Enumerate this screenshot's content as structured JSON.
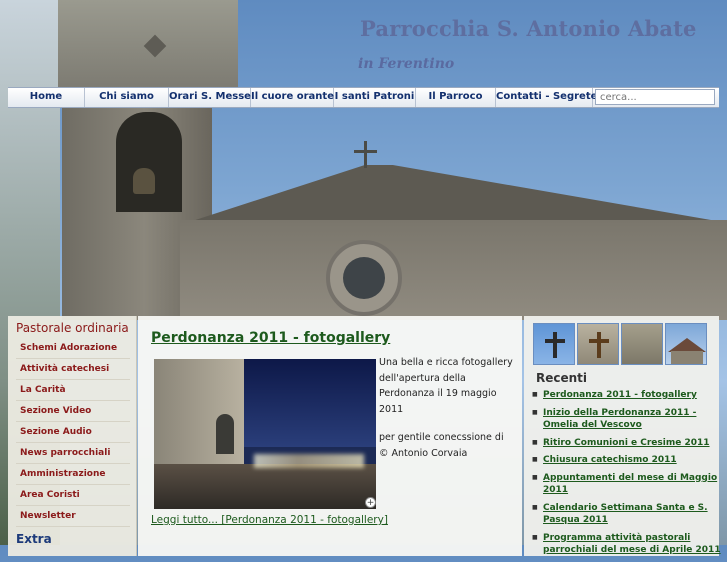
{
  "header": {
    "title": "Parrocchia S. Antonio Abate",
    "subtitle": "in Ferentino"
  },
  "nav": {
    "items": [
      "Home",
      "Chi siamo",
      "Orari S. Messe",
      "Il cuore orante",
      "I santi Patroni",
      "Il Parroco",
      "Contatti - Segreteria"
    ]
  },
  "search": {
    "placeholder": "cerca..."
  },
  "sidebar": {
    "heading": "Pastorale ordinaria",
    "items": [
      "Schemi Adorazione",
      "Attività catechesi",
      "La Carità",
      "Sezione Video",
      "Sezione Audio",
      "News parrocchiali",
      "Amministrazione",
      "Area Coristi",
      "Newsletter"
    ],
    "heading2": "Extra"
  },
  "article": {
    "title": "Perdonanza 2011 - fotogallery",
    "text": "Una bella e ricca fotogallery dell'apertura della Perdonanza il 19 maggio 2011",
    "credit": "per gentile conecssione di © Antonio Corvaia",
    "read_more": "Leggi tutto... [Perdonanza 2011 - fotogallery]"
  },
  "recent": {
    "heading": "Recenti",
    "items": [
      "Perdonanza 2011 - fotogallery",
      "Inizio della Perdonanza 2011 - Omelia del Vescovo",
      "Ritiro Comunioni e Cresime 2011",
      "Chiusura catechismo 2011",
      "Appuntamenti del mese di Maggio 2011",
      "Calendario Settimana Santa e S. Pasqua 2011",
      "Programma attività pastorali parrochiali del mese di Aprile 2011"
    ]
  },
  "thumbnails": [
    "cross-on-sky-icon",
    "iron-cross-icon",
    "stone-wall-icon",
    "church-roof-icon"
  ],
  "colors": {
    "title": "#5e6ea0",
    "nav_text": "#13306e",
    "sidebar_text": "#8b1a1a",
    "link_green": "#1d5a1d"
  }
}
